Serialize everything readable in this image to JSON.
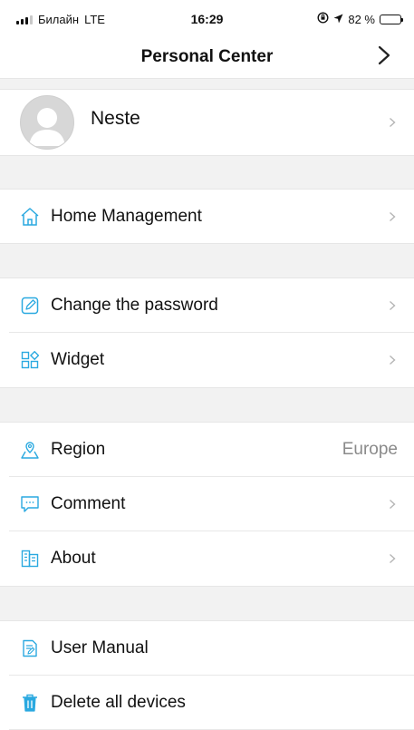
{
  "status_bar": {
    "carrier": "Билайн",
    "network": "LTE",
    "time": "16:29",
    "battery_percent": "82 %"
  },
  "header": {
    "title": "Personal Center"
  },
  "profile": {
    "name": "Neste"
  },
  "menu": {
    "home_management": "Home Management",
    "change_password": "Change the password",
    "widget": "Widget",
    "region": "Region",
    "region_value": "Europe",
    "comment": "Comment",
    "about": "About",
    "user_manual": "User Manual",
    "delete_all": "Delete all devices"
  },
  "colors": {
    "accent": "#2aa9e0",
    "chevron": "#b5b5b5",
    "section_gap": "#f2f2f2"
  }
}
